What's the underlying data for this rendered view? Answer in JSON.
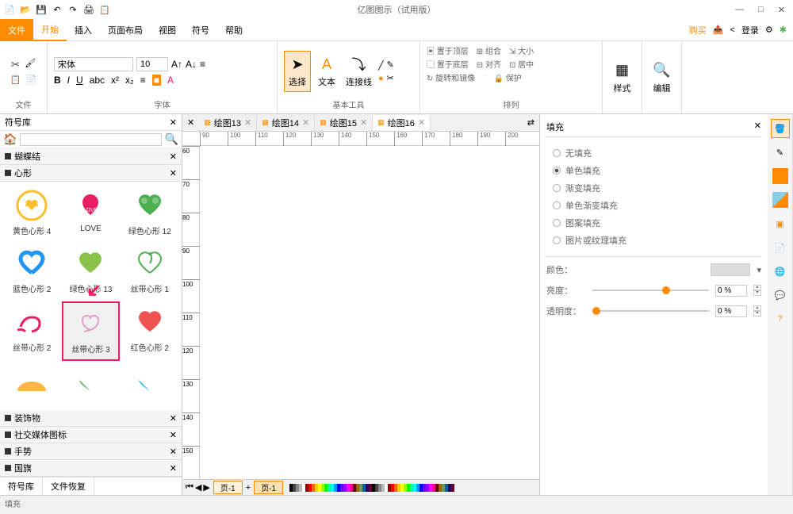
{
  "app": {
    "title": "亿图图示（试用版）"
  },
  "window_controls": {
    "min": "—",
    "max": "□",
    "close": "✕"
  },
  "menu": {
    "file": "文件",
    "tabs": [
      "开始",
      "插入",
      "页面布局",
      "视图",
      "符号",
      "帮助"
    ],
    "right": {
      "buy": "购买",
      "login": "登录"
    }
  },
  "ribbon": {
    "file_group": "文件",
    "font_group": "字体",
    "font_name": "宋体",
    "font_size": "10",
    "tools_group": "基本工具",
    "select": "选择",
    "text": "文本",
    "connector": "连接线",
    "arrange_group": "排列",
    "to_front": "置于顶层",
    "to_back": "置于底层",
    "rotate": "旋转和镜像",
    "group": "组合",
    "align": "对齐",
    "size": "大小",
    "center": "居中",
    "protect": "保护",
    "style_group": "样式",
    "edit_group": "编辑"
  },
  "symbol_panel": {
    "title": "符号库",
    "categories": {
      "bowtie": "蝴蝶结",
      "heart": "心形",
      "decoration": "装饰物",
      "social": "社交媒体图标",
      "gesture": "手势",
      "flag": "国旗"
    },
    "shapes": [
      {
        "name": "黄色心形",
        "count": "4"
      },
      {
        "name": "LOVE",
        "count": ""
      },
      {
        "name": "绿色心形",
        "count": "12"
      },
      {
        "name": "蓝色心形",
        "count": "2"
      },
      {
        "name": "绿色心形",
        "count": "13"
      },
      {
        "name": "丝带心形",
        "count": "1"
      },
      {
        "name": "丝带心形",
        "count": "2"
      },
      {
        "name": "丝带心形",
        "count": "3"
      },
      {
        "name": "红色心形",
        "count": "2"
      }
    ],
    "bottom_tabs": [
      "符号库",
      "文件恢复"
    ]
  },
  "doc_tabs": [
    "绘图13",
    "绘图14",
    "绘图15",
    "绘图16"
  ],
  "ruler_h": [
    "90",
    "100",
    "110",
    "120",
    "130",
    "140",
    "150",
    "160",
    "170",
    "180",
    "190",
    "200"
  ],
  "ruler_v": [
    "60",
    "70",
    "80",
    "90",
    "100",
    "110",
    "120",
    "130",
    "140",
    "150"
  ],
  "page": {
    "label1": "页-1",
    "label2": "页-1"
  },
  "fill_panel": {
    "title": "填充",
    "options": [
      "无填充",
      "单色填充",
      "渐变填充",
      "单色渐变填充",
      "图案填充",
      "图片或纹理填充"
    ],
    "color": "颜色：",
    "brightness": "亮度：",
    "brightness_val": "0 %",
    "opacity": "透明度：",
    "opacity_val": "0 %"
  },
  "status": "填充"
}
